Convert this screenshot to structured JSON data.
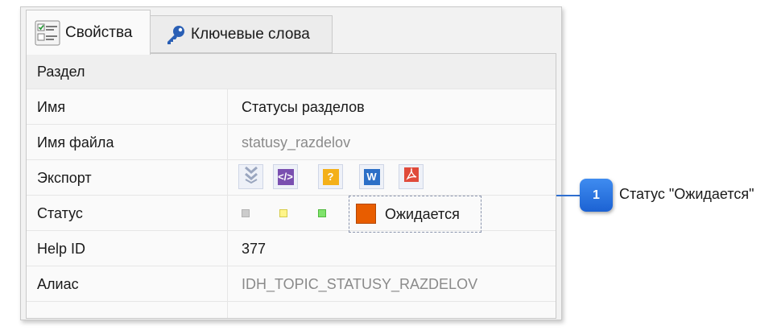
{
  "tabs": [
    {
      "label": "Свойства",
      "icon": "properties-icon",
      "active": true
    },
    {
      "label": "Ключевые слова",
      "icon": "key-icon",
      "active": false
    }
  ],
  "properties": {
    "section": "Раздел",
    "name": {
      "label": "Имя",
      "value": "Статусы разделов"
    },
    "file_name": {
      "label": "Имя файла",
      "value": "statusy_razdelov"
    },
    "export": {
      "label": "Экспорт",
      "buttons": [
        "check-icon",
        "html-icon",
        "chm-help-icon",
        "word-icon",
        "pdf-icon"
      ],
      "button_glyphs": {
        "html": "</>",
        "chm": "?",
        "word": "W"
      }
    },
    "status": {
      "label": "Статус",
      "value": "Ожидается",
      "colors": {
        "gray": "#cccccc",
        "yellow": "#fff58a",
        "green": "#7fe36b",
        "orange": "#e85d00"
      }
    },
    "help_id": {
      "label": "Help ID",
      "value": "377"
    },
    "alias": {
      "label": "Алиас",
      "value": "IDH_TOPIC_STATUSY_RAZDELOV"
    }
  },
  "callout": {
    "number": "1",
    "text": "Статус \"Ожидается\"",
    "color": "#2f6fd0"
  }
}
